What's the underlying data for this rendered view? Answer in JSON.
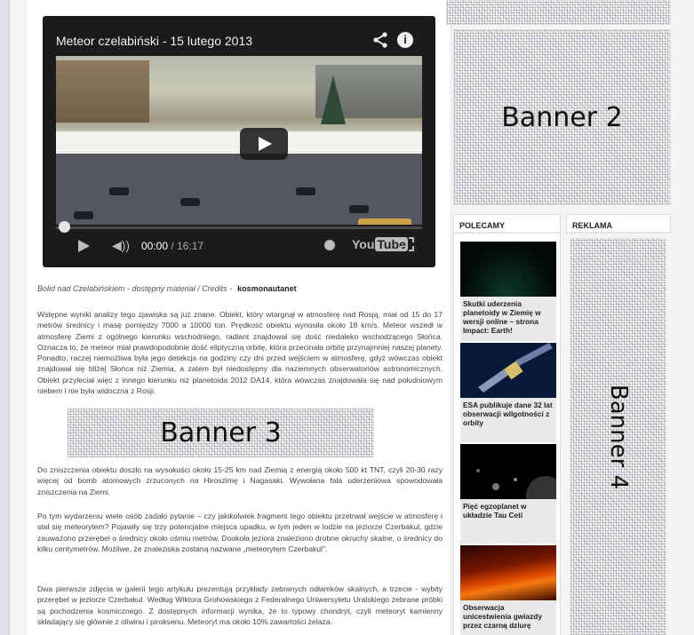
{
  "video": {
    "title": "Meteor czelabiński - 15 lutego 2013",
    "current_time": "00:00",
    "duration": "/ 16:17",
    "progress": 0,
    "logo_text": "You",
    "logo_box": "Tube"
  },
  "article": {
    "caption_prefix": "Bolid nad Czelabińskiem - dostępny materiał / Credits -",
    "caption_credit": "kosmonautanet",
    "paragraphs": [
      "Wstępne wyniki analizy tego zjawiska są już znane. Obiekt, który wtargnął w atmosferę nad Rosją, miał od 15 do 17 metrów średnicy i masę pomiędzy 7000 a 10000 ton. Prędkość obiektu wynosiła około 18 km/s. Meteor wszedł w atmosferę Ziemi z ogólnego kierunku wschodniego, radiant znajdował się dość niedaleko wschodzącego Słońca. Oznacza to, że meteor miał prawdopodobnie dość eliptyczną orbitę, która przecinała orbitę przynajmniej naszej planety. Ponadto, raczej niemożliwa była jego detekcja na godziny czy dni przed wejściem w atmosferę, gdyż wówczas obiekt znajdował się bliżej Słońca niż Ziemia, a zatem był niedostępny dla naziemnych obserwatoriów astronomicznych. Obiekt przyleciał więc z innego kierunku niż planetoida 2012 DA14, która wówczas znajdowała się nad południowym niebem i nie była widoczna z Rosji.",
      "Do zniszczenia obiektu doszło na wysokości około 15-25 km nad Ziemią z energią około 500 kt TNT, czyli 20-30 razy więcej od bomb atomowych zrzuconych na Hiroszimę i Nagasaki. Wywołana fala uderzeniowa spowodowała zniszczenia na Ziemi.",
      "Po tym wydarzeniu wiele osób zadało pytanie – czy jakikolwiek fragment tego obiektu przetrwał wejście w atmosferę i stał się meteorytem? Pojawiły się trzy potencjalne miejsca upadku, w tym jeden w lodzie na jeziorze Czerbakul, gdzie zauważono przerębel o średnicy około ośmiu metrów. Dookoła jeziora znaleziono drobne okruchy skalne, o średnicy do kilku centymetrów. Możliwe, że znaleziska zostaną nazwane „meteorytem Czerbakul\".",
      "Dwa pierwsze zdjęcia w galerii tego artykułu prezentują przykłady zebranych odłamków skalnych, a trzecie - wybity przerębel w jeziorze Czerbakul. Według Wiktora Grohowskiego z Federalnego Uniwersytetu Uralskiego zebrane próbki są pochodzenia kosmicznego. Z dostępnych informacji wynika, że to typowy chondryt, czyli meteoryt kamienny składający się głównie z oliwinu i piroksenu. Meteoryt ma około 10% zawartości żelaza."
    ]
  },
  "banners": {
    "banner2": "Banner 2",
    "banner3": "Banner 3",
    "banner4": "Banner 4"
  },
  "sidebar": {
    "polecamy_title": "POLECAMY",
    "reklama_title": "REKLAMA",
    "recommended": [
      {
        "title": "Skutki uderzenia planetoidy w Ziemię w wersji online – strona Impact: Earth!"
      },
      {
        "title": "ESA publikuje dane 32 lat obserwacji wilgotności z orbity"
      },
      {
        "title": "Pięć egzoplanet w układzie Tau Ceti"
      },
      {
        "title": "Obserwacja unicestwienia gwiazdy przez czarną dziurę"
      }
    ]
  }
}
